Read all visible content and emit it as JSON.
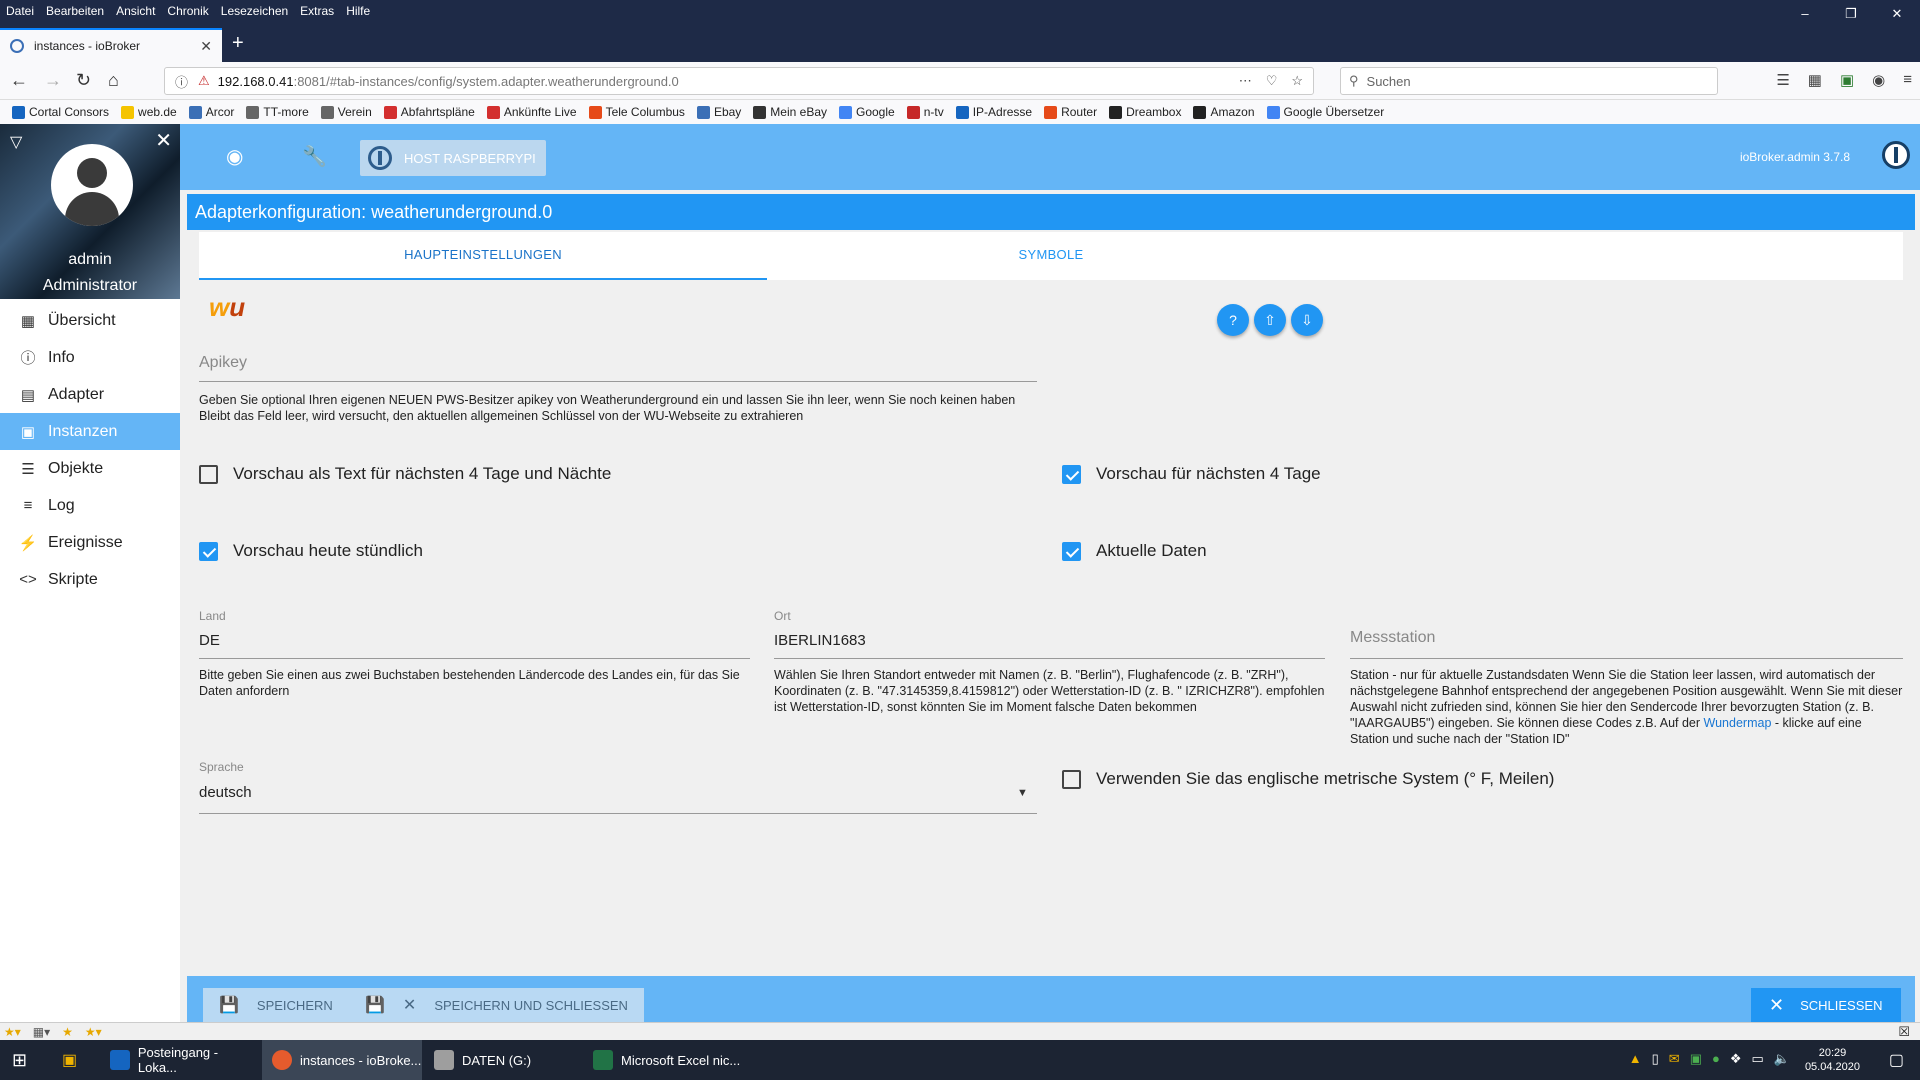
{
  "browser": {
    "menu": [
      "Datei",
      "Bearbeiten",
      "Ansicht",
      "Chronik",
      "Lesezeichen",
      "Extras",
      "Hilfe"
    ],
    "tab_title": "instances - ioBroker",
    "url_host": "192.168.0.41",
    "url_rest": ":8081/#tab-instances/config/system.adapter.weatherunderground.0",
    "search_placeholder": "Suchen",
    "bookmarks": [
      {
        "label": "Cortal Consors",
        "color": "#1565c0"
      },
      {
        "label": "web.de",
        "color": "#f5c400"
      },
      {
        "label": "Arcor",
        "color": "#3b6fb6"
      },
      {
        "label": "TT-more",
        "color": "#666666"
      },
      {
        "label": "Verein",
        "color": "#666666"
      },
      {
        "label": "Abfahrtspläne",
        "color": "#d32f2f"
      },
      {
        "label": "Ankünfte Live",
        "color": "#d32f2f"
      },
      {
        "label": "Tele Columbus",
        "color": "#e64a19"
      },
      {
        "label": "Ebay",
        "color": "#3b6fb6"
      },
      {
        "label": "Mein eBay",
        "color": "#333333"
      },
      {
        "label": "Google",
        "color": "#4285f4"
      },
      {
        "label": "n-tv",
        "color": "#c62828"
      },
      {
        "label": "IP-Adresse",
        "color": "#1565c0"
      },
      {
        "label": "Router",
        "color": "#e64a19"
      },
      {
        "label": "Dreambox",
        "color": "#222222"
      },
      {
        "label": "Amazon",
        "color": "#222222"
      },
      {
        "label": "Google Übersetzer",
        "color": "#4285f4"
      }
    ]
  },
  "sidebar": {
    "user_name": "admin",
    "user_role": "Administrator",
    "items": [
      {
        "label": "Übersicht",
        "icon": "grid-icon"
      },
      {
        "label": "Info",
        "icon": "info-icon"
      },
      {
        "label": "Adapter",
        "icon": "store-icon"
      },
      {
        "label": "Instanzen",
        "icon": "instances-icon"
      },
      {
        "label": "Objekte",
        "icon": "list-icon"
      },
      {
        "label": "Log",
        "icon": "log-icon"
      },
      {
        "label": "Ereignisse",
        "icon": "bolt-icon"
      },
      {
        "label": "Skripte",
        "icon": "code-icon"
      }
    ]
  },
  "appbar": {
    "host_label": "HOST RASPBERRYPI",
    "version": "ioBroker.admin 3.7.8"
  },
  "dialog": {
    "title": "Adapterkonfiguration: weatherunderground.0",
    "tabs": [
      "HAUPTEINSTELLUNGEN",
      "SYMBOLE"
    ],
    "logo_text_1": "w",
    "logo_text_2": "u",
    "apikey": {
      "placeholder": "Apikey",
      "help": "Geben Sie optional Ihren eigenen NEUEN PWS-Besitzer apikey von Weatherunderground ein und lassen Sie ihn leer, wenn Sie noch keinen haben Bleibt das Feld leer, wird versucht, den aktuellen allgemeinen Schlüssel von der WU-Webseite zu extrahieren"
    },
    "checkboxes": {
      "forecast_text": {
        "label": "Vorschau als Text für nächsten 4 Tage und Nächte",
        "checked": false
      },
      "forecast_4days": {
        "label": "Vorschau für nächsten 4 Tage",
        "checked": true
      },
      "forecast_hourly": {
        "label": "Vorschau heute stündlich",
        "checked": true
      },
      "current": {
        "label": "Aktuelle Daten",
        "checked": true
      },
      "imperial": {
        "label": "Verwenden Sie das englische metrische System (° F, Meilen)",
        "checked": false
      }
    },
    "land": {
      "label": "Land",
      "value": "DE",
      "help": "Bitte geben Sie einen aus zwei Buchstaben bestehenden Ländercode des Landes ein, für das Sie Daten anfordern"
    },
    "ort": {
      "label": "Ort",
      "value": "IBERLIN1683",
      "help": "Wählen Sie Ihren Standort entweder mit Namen (z. B. \"Berlin\"), Flughafencode (z. B. \"ZRH\"), Koordinaten (z. B. \"47.3145359,8.4159812\") oder Wetterstation-ID (z. B. \" IZRICHZR8\"). empfohlen ist Wetterstation-ID, sonst könnten Sie im Moment falsche Daten bekommen"
    },
    "station": {
      "placeholder": "Messstation",
      "help_1": "Station - nur für aktuelle Zustandsdaten Wenn Sie die Station leer lassen, wird automatisch der nächstgelegene Bahnhof entsprechend der angegebenen Position ausgewählt. Wenn Sie mit dieser Auswahl nicht zufrieden sind, können Sie hier den Sendercode Ihrer bevorzugten Station (z. B. \"IAARGAUB5\") eingeben. Sie können diese Codes z.B. Auf der ",
      "help_link": "Wundermap",
      "help_2": " - klicke auf eine Station und suche nach der \"Station ID\""
    },
    "sprache": {
      "label": "Sprache",
      "value": "deutsch"
    },
    "buttons": {
      "save": "SPEICHERN",
      "save_close": "SPEICHERN UND SCHLIESSEN",
      "close": "SCHLIESSEN"
    }
  },
  "taskbar": {
    "apps": [
      "Posteingang - Loka...",
      "instances - ioBroke...",
      "DATEN (G:)",
      "Microsoft Excel nic..."
    ],
    "time": "20:29",
    "date": "05.04.2020"
  }
}
